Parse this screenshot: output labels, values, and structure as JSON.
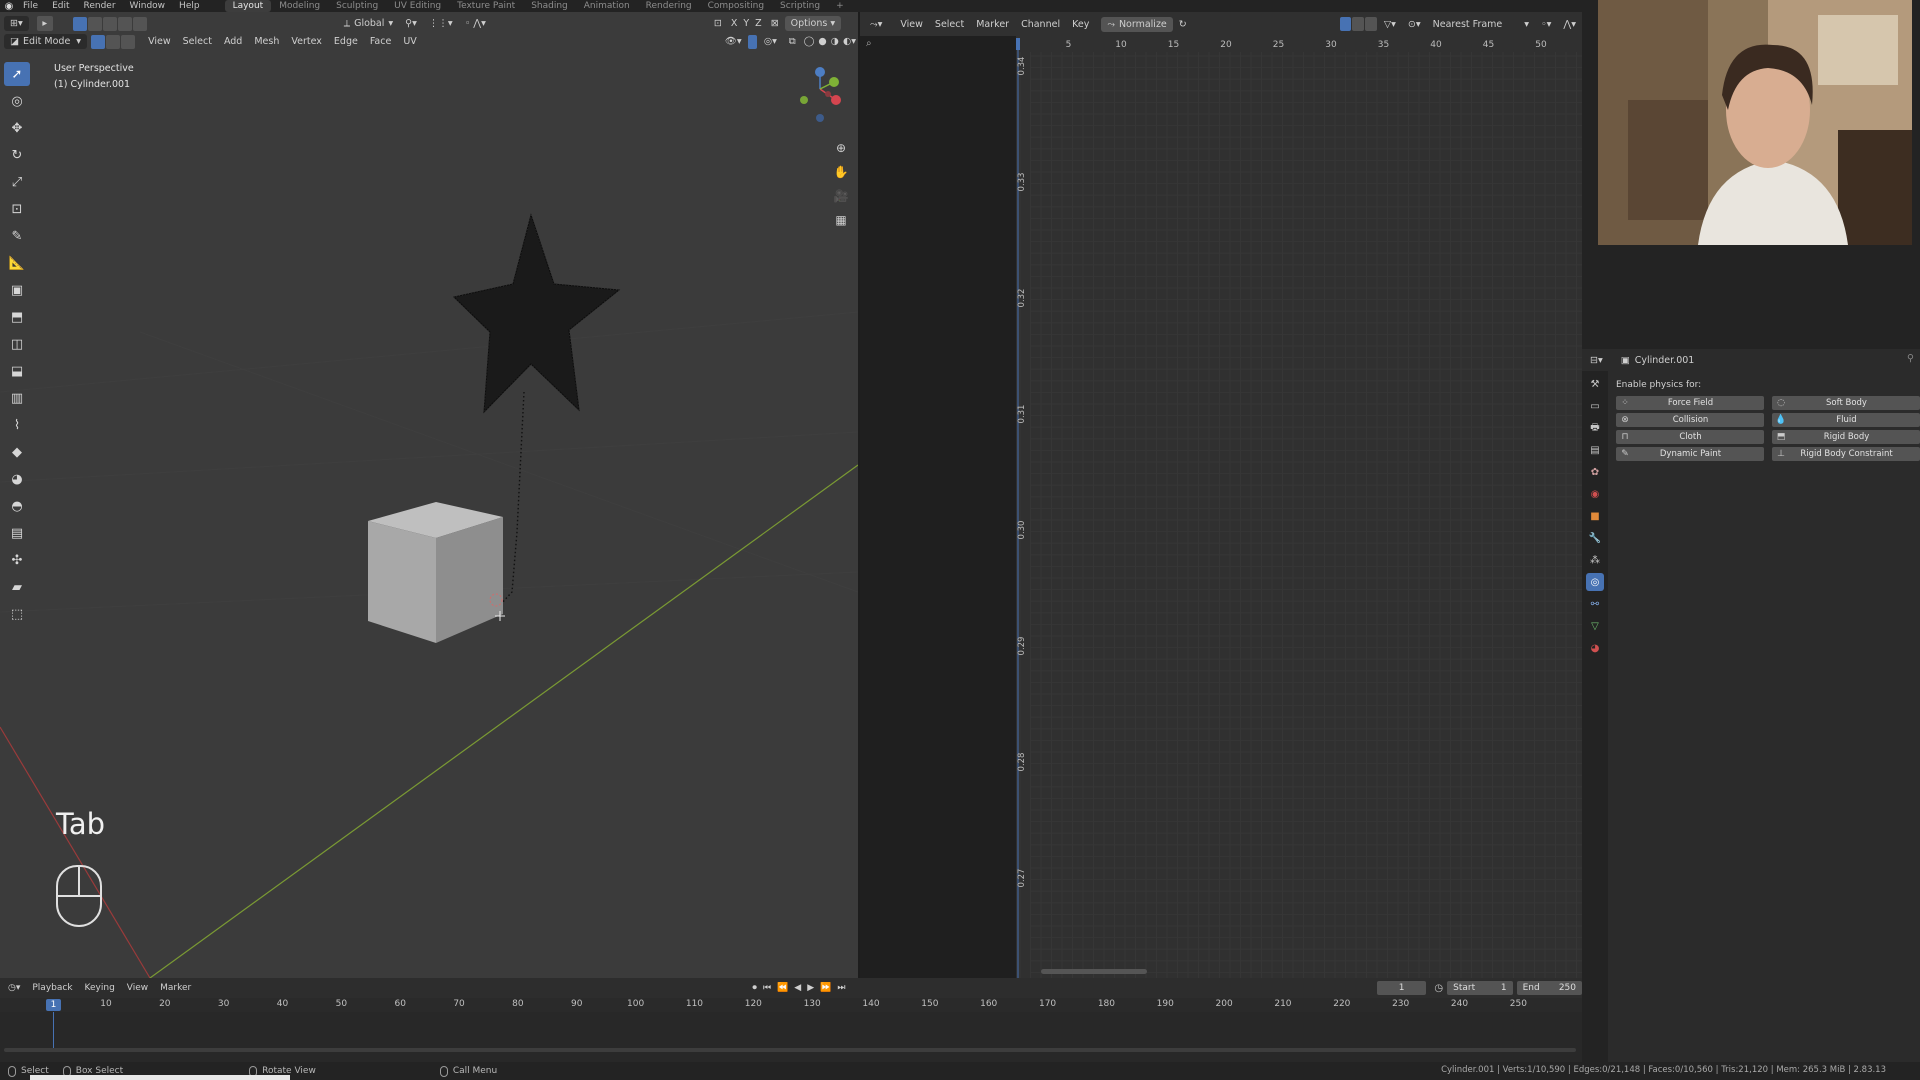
{
  "topbar": {
    "menus": [
      "File",
      "Edit",
      "Render",
      "Window",
      "Help"
    ],
    "workspaces": [
      "Layout",
      "Modeling",
      "Sculpting",
      "UV Editing",
      "Texture Paint",
      "Shading",
      "Animation",
      "Rendering",
      "Compositing",
      "Scripting"
    ],
    "active_workspace": "Layout",
    "add_tab": "+"
  },
  "viewport": {
    "transform_orientation": "Global",
    "options_label": "Options",
    "mode": "Edit Mode",
    "menus": [
      "View",
      "Select",
      "Add",
      "Mesh",
      "Vertex",
      "Edge",
      "Face",
      "UV"
    ],
    "axes": [
      "X",
      "Y",
      "Z"
    ],
    "view_name": "User Perspective",
    "object_name": "(1) Cylinder.001",
    "key_hint": "Tab",
    "colors": {
      "background": "#3b3b3b",
      "x_axis": "#9a3b3b",
      "y_axis": "#7a9a33",
      "selection": "#4772b3"
    }
  },
  "graph_editor": {
    "menus": [
      "View",
      "Select",
      "Marker",
      "Channel",
      "Key"
    ],
    "normalize_label": "Normalize",
    "snap_mode": "Nearest Frame",
    "x_ticks": [
      "5",
      "10",
      "15",
      "20",
      "25",
      "30",
      "35",
      "40",
      "45",
      "50"
    ],
    "y_ticks": [
      "0.34",
      "0.33",
      "0.32",
      "0.31",
      "0.30",
      "0.29",
      "0.28",
      "0.27"
    ]
  },
  "properties": {
    "object_name": "Cylinder.001",
    "physics_title": "Enable physics for:",
    "physics_buttons": [
      {
        "label": "Force Field",
        "icon": "force-field-icon"
      },
      {
        "label": "Soft Body",
        "icon": "soft-body-icon"
      },
      {
        "label": "Collision",
        "icon": "collision-icon"
      },
      {
        "label": "Fluid",
        "icon": "fluid-icon"
      },
      {
        "label": "Cloth",
        "icon": "cloth-icon"
      },
      {
        "label": "Rigid Body",
        "icon": "rigid-body-icon"
      },
      {
        "label": "Dynamic Paint",
        "icon": "dynamic-paint-icon"
      },
      {
        "label": "Rigid Body Constraint",
        "icon": "rigid-body-constraint-icon"
      }
    ]
  },
  "timeline": {
    "menus": [
      "Playback",
      "Keying",
      "View",
      "Marker"
    ],
    "current_frame": "1",
    "start_label": "Start",
    "start_value": "1",
    "end_label": "End",
    "end_value": "250",
    "ruler": [
      "1",
      "10",
      "20",
      "30",
      "40",
      "50",
      "60",
      "70",
      "80",
      "90",
      "100",
      "110",
      "120",
      "130",
      "140",
      "150",
      "160",
      "170",
      "180",
      "190",
      "200",
      "210",
      "220",
      "230",
      "240",
      "250"
    ]
  },
  "statusbar": {
    "select": "Select",
    "box_select": "Box Select",
    "rotate_view": "Rotate View",
    "call_menu": "Call Menu",
    "stats": "Cylinder.001 | Verts:1/10,590 | Edges:0/21,148 | Faces:0/10,560 | Tris:21,120 | Mem: 265.3 MiB | 2.83.13"
  }
}
